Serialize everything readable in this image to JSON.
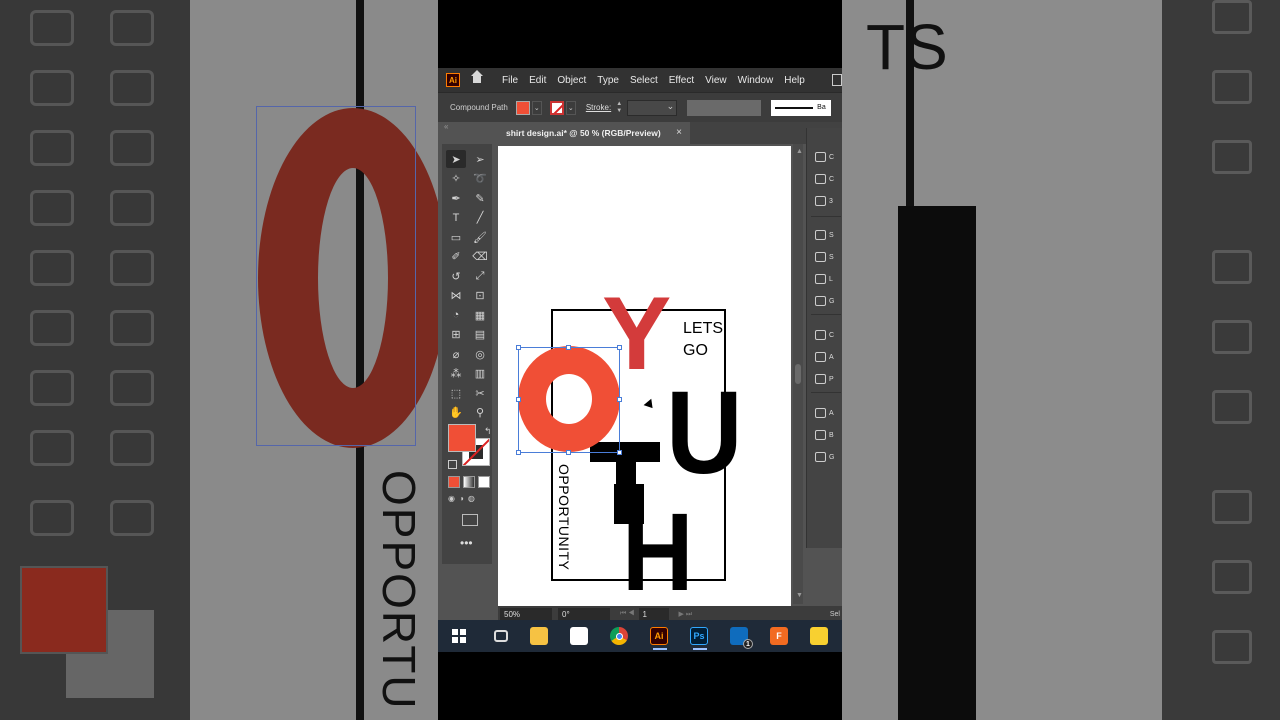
{
  "menubar": {
    "app_logo": "Ai",
    "items": [
      "File",
      "Edit",
      "Object",
      "Type",
      "Select",
      "Effect",
      "View",
      "Window",
      "Help"
    ]
  },
  "control_bar": {
    "selection_type": "Compound Path",
    "stroke_label": "Stroke:",
    "brush_label": "Ba",
    "fill_color": "#f04f36"
  },
  "document": {
    "tab_title": "shirt design.ai* @ 50 % (RGB/Preview)",
    "close_symbol": "×"
  },
  "artwork": {
    "letter_y": "Y",
    "letter_u": "U",
    "letter_h": "H",
    "lets_go": [
      "LETS",
      "GO"
    ],
    "opportunity": "OPPORTUNITY",
    "colors": {
      "orange": "#f04f36",
      "red": "#d33b3b",
      "black": "#000000"
    }
  },
  "statusbar": {
    "zoom": "50%",
    "rotation": "0°",
    "page": "1",
    "selection": "Sel"
  },
  "background": {
    "right_text_fragment": "TS",
    "left_vertical_text": "OPPORTU"
  },
  "right_panel": {
    "items": [
      "C",
      "C",
      "3",
      "S",
      "S",
      "L",
      "G",
      "C",
      "A",
      "P",
      "A",
      "B",
      "G"
    ]
  },
  "taskbar": {
    "apps": [
      "windows-start",
      "task-view",
      "file-explorer",
      "microsoft-store",
      "chrome",
      "illustrator",
      "photoshop",
      "mail",
      "foxit",
      "sticky-notes"
    ],
    "illustrator_label": "Ai",
    "photoshop_label": "Ps",
    "mail_badge": "1",
    "foxit_label": "F"
  }
}
